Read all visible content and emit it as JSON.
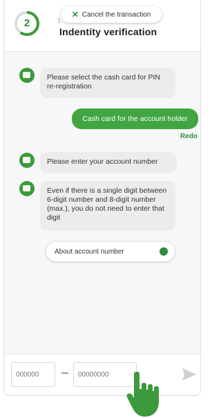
{
  "header": {
    "progress_step": "2",
    "step_label": "1",
    "title": "Indentity verification",
    "cancel_label": "Cancel the transaction"
  },
  "messages": [
    {
      "from": "bot",
      "text": "Please select the cash card for PIN re-registration"
    },
    {
      "from": "user",
      "text": "Cash card for the account holder"
    },
    {
      "from": "bot",
      "text": "Please enter your account number"
    },
    {
      "from": "bot",
      "text": "Even if there is a single digit between 6-digit number and 8-digit number (max.), you do not need to enter that digit"
    }
  ],
  "redo_label": "Redo",
  "option_button": {
    "label": "About account number"
  },
  "input": {
    "branch_placeholder": "000000",
    "account_placeholder": "00000000"
  },
  "colors": {
    "accent": "#41a641",
    "accent_dark": "#2e8b3e",
    "bubble": "#ececec"
  }
}
